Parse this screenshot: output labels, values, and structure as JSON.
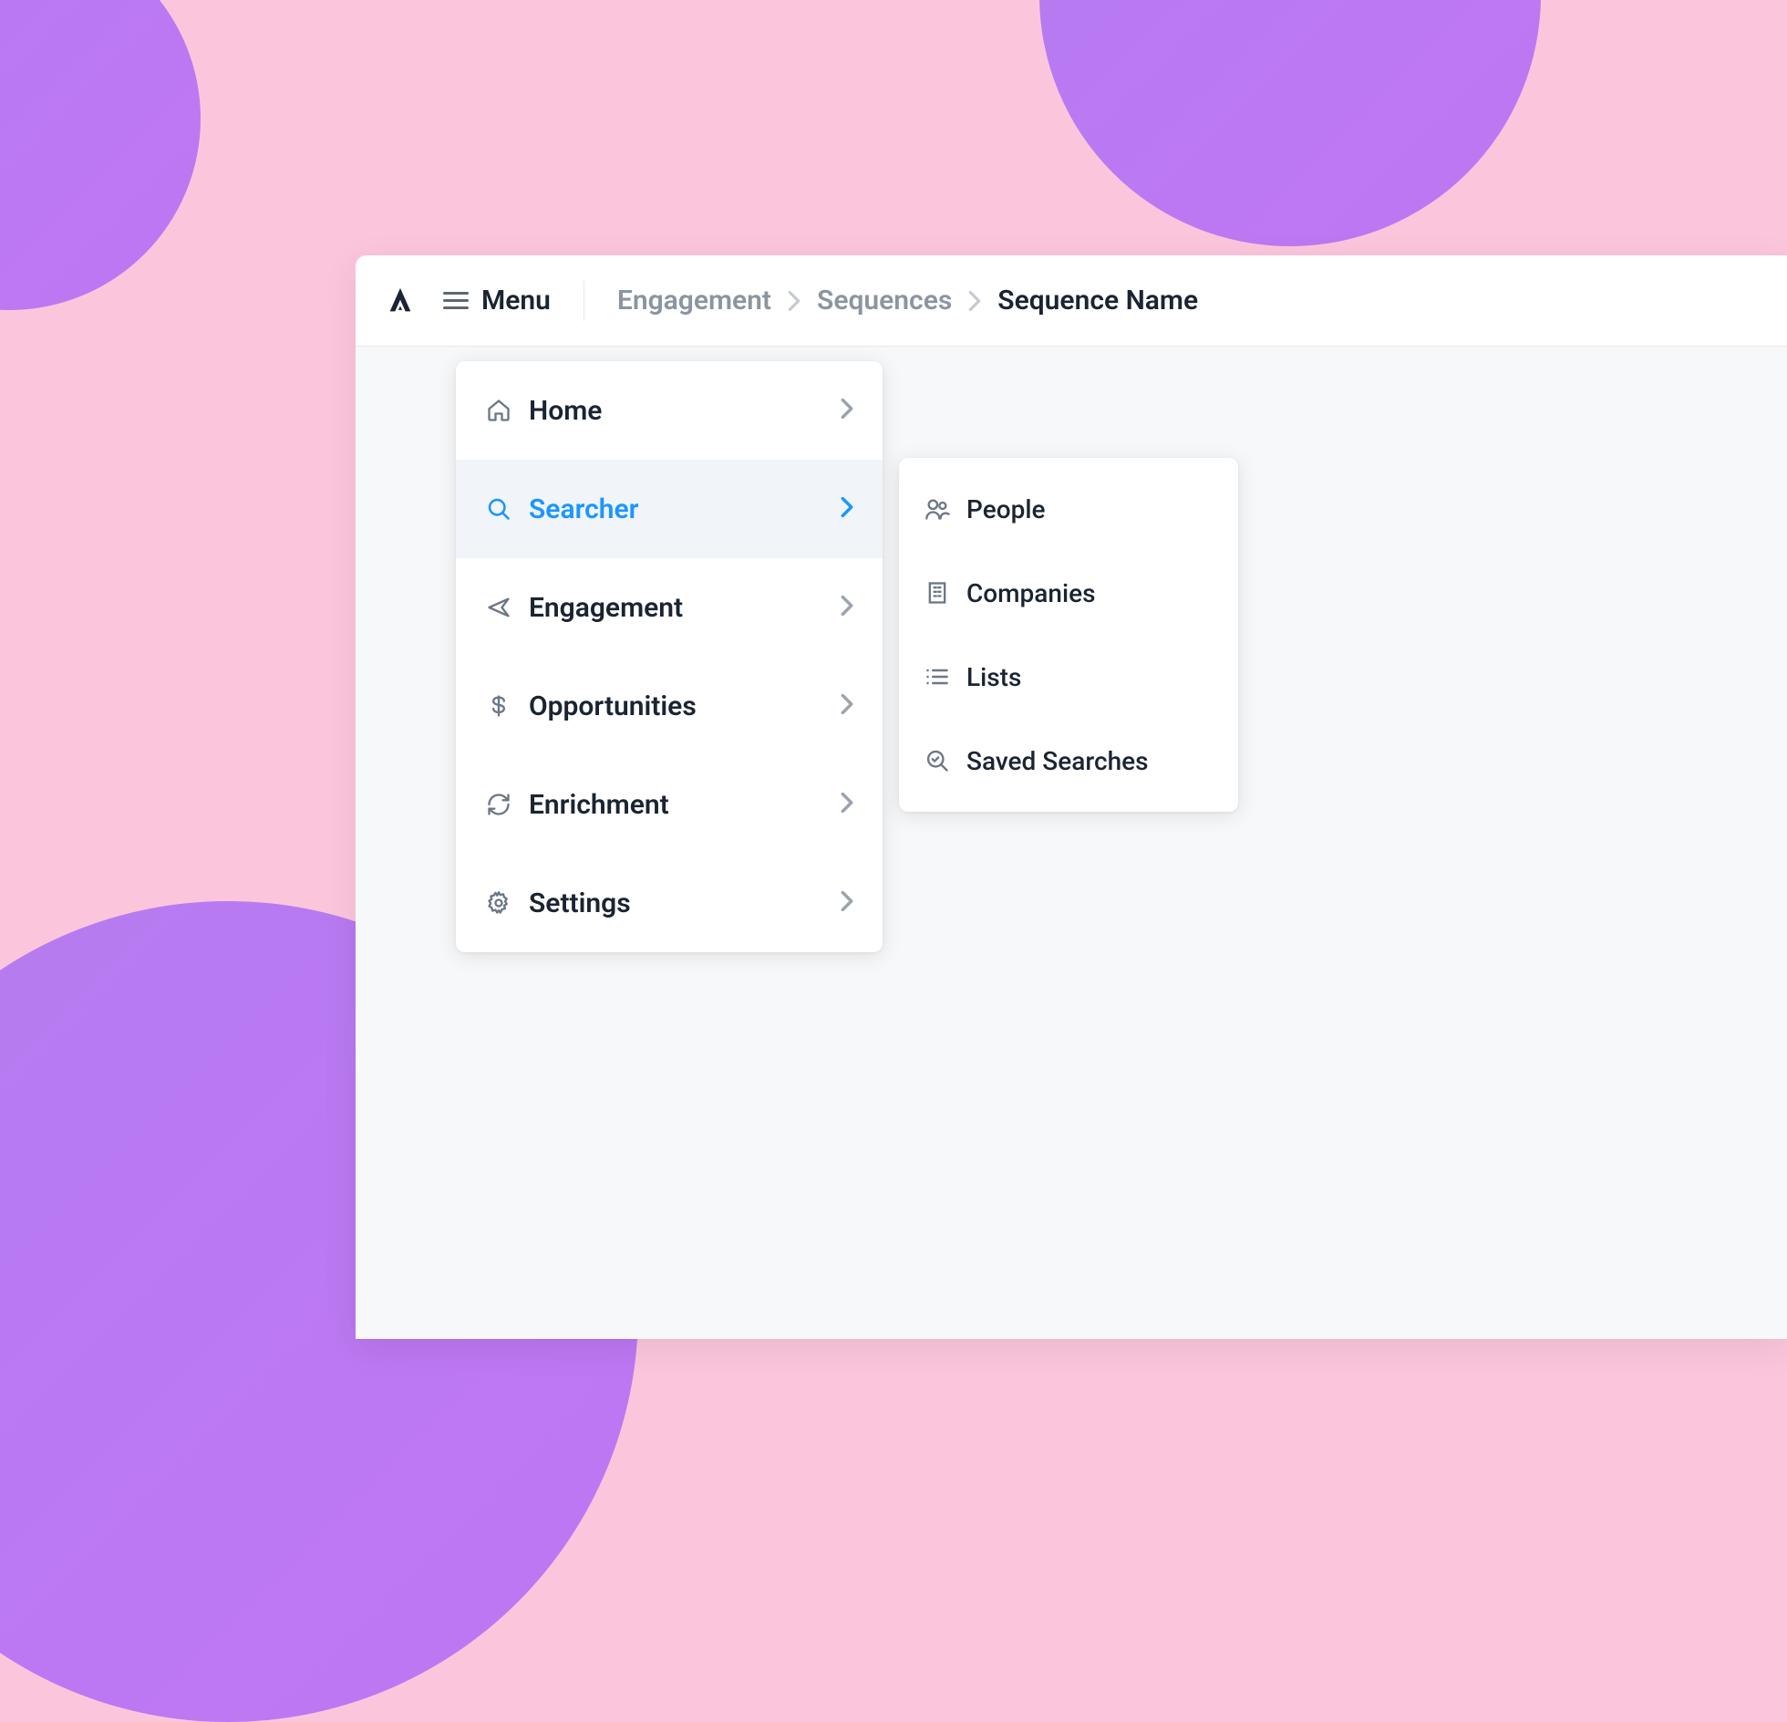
{
  "header": {
    "menu_label": "Menu",
    "breadcrumb": {
      "items": [
        "Engagement",
        "Sequences",
        "Sequence Name"
      ]
    }
  },
  "menu": {
    "items": [
      {
        "label": "Home",
        "icon": "home"
      },
      {
        "label": "Searcher",
        "icon": "search",
        "active": true
      },
      {
        "label": "Engagement",
        "icon": "send"
      },
      {
        "label": "Opportunities",
        "icon": "dollar"
      },
      {
        "label": "Enrichment",
        "icon": "refresh"
      },
      {
        "label": "Settings",
        "icon": "gear"
      }
    ]
  },
  "submenu": {
    "items": [
      {
        "label": "People",
        "icon": "people"
      },
      {
        "label": "Companies",
        "icon": "building"
      },
      {
        "label": "Lists",
        "icon": "list"
      },
      {
        "label": "Saved Searches",
        "icon": "saved-search"
      }
    ]
  }
}
